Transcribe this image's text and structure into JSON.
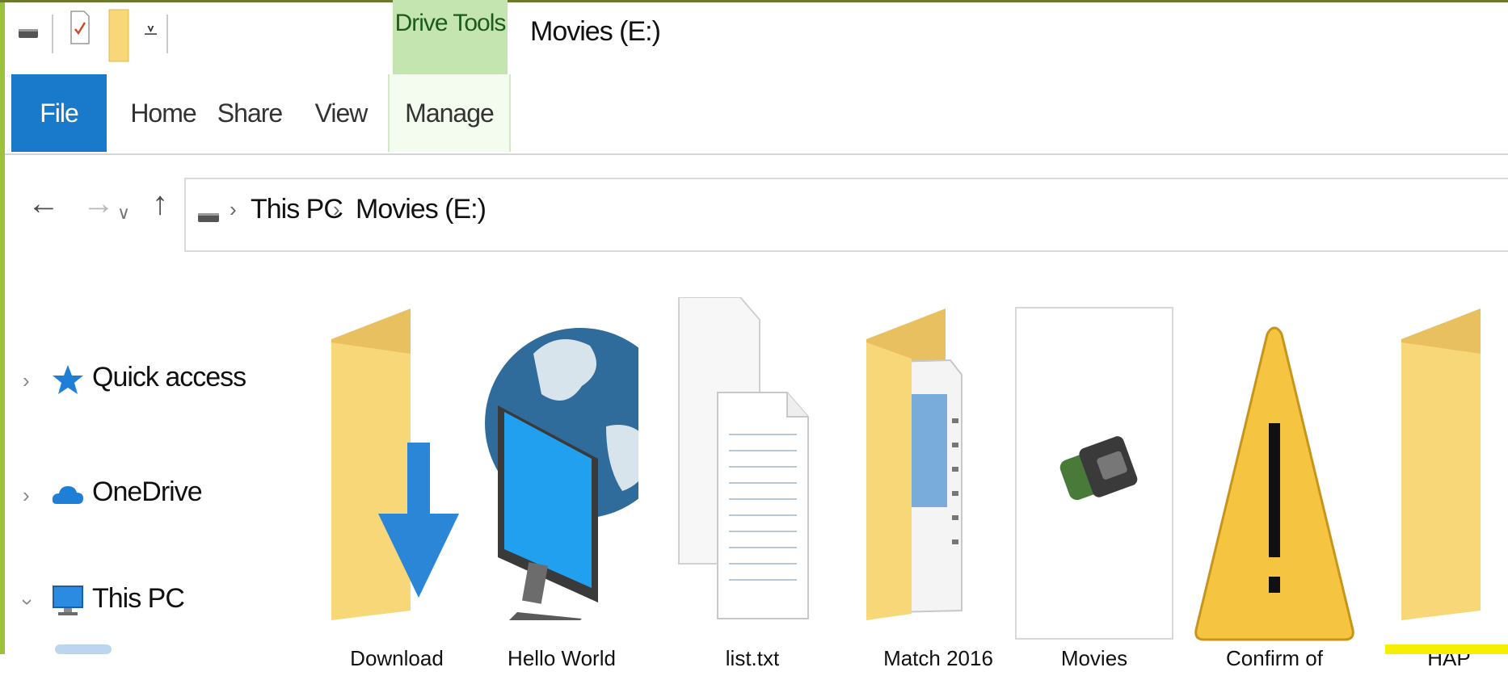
{
  "window": {
    "title": "Movies (E:)",
    "contextual_tab_group": "Drive Tools"
  },
  "ribbon": {
    "tabs": [
      {
        "label": "File",
        "selected": true
      },
      {
        "label": "Home"
      },
      {
        "label": "Share"
      },
      {
        "label": "View"
      },
      {
        "label": "Manage",
        "contextual": true
      }
    ]
  },
  "address_bar": {
    "breadcrumbs": [
      "This PC",
      "Movies (E:)"
    ]
  },
  "navigation_pane": {
    "items": [
      {
        "label": "Quick access",
        "icon": "star-icon",
        "expanded": false
      },
      {
        "label": "OneDrive",
        "icon": "cloud-icon",
        "expanded": false
      },
      {
        "label": "This PC",
        "icon": "computer-icon",
        "expanded": true
      }
    ]
  },
  "content": {
    "items": [
      {
        "icon": "downloads-folder-icon",
        "caption": "Download"
      },
      {
        "icon": "network-globe-icon",
        "caption": "Hello World"
      },
      {
        "icon": "document-icon",
        "caption": "list.txt"
      },
      {
        "icon": "document-folder-icon",
        "caption": "Match 2016"
      },
      {
        "icon": "flash-drive-icon",
        "caption": "Movies"
      },
      {
        "icon": "warning-icon",
        "caption": "Confirm of"
      },
      {
        "icon": "folder-icon",
        "caption": "HAP"
      }
    ]
  },
  "colors": {
    "file_tab": "#1979ca",
    "drive_tools_tab": "#c5e5b0",
    "window_frame": "#9bc23a",
    "folder_yellow": "#f7d778",
    "warning_yellow": "#f5c542"
  }
}
